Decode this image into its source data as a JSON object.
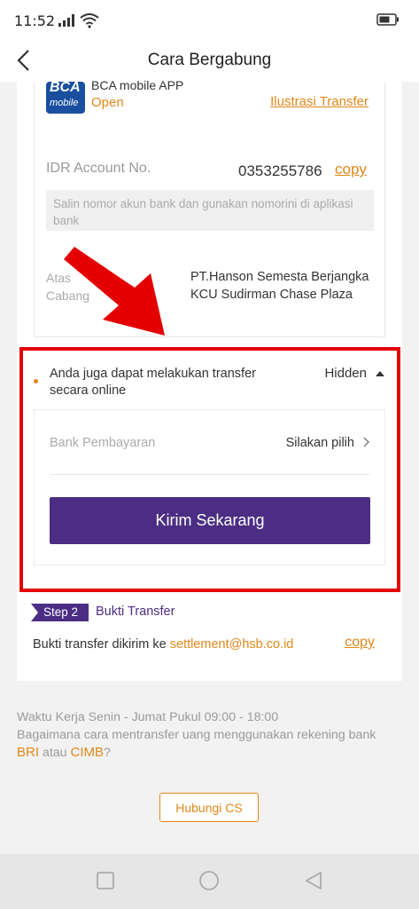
{
  "status_bar": {
    "time": "11:52"
  },
  "header": {
    "title": "Cara Bergabung"
  },
  "bca": {
    "logo_line1": "BCA",
    "logo_line2": "mobile",
    "app_name": "BCA mobile APP",
    "open_label": "Open",
    "illustration_link": "Ilustrasi Transfer"
  },
  "account": {
    "label": "IDR Account No.",
    "number": "0353255786",
    "copy_label": "copy",
    "hint": "Salin nomor akun bank dan gunakan nomorini di aplikasi bank"
  },
  "info_rows": [
    {
      "label": "Atas",
      "value": "PT.Hanson Semesta Berjangka"
    },
    {
      "label": "Cabang",
      "value": "KCU Sudirman Chase Plaza"
    }
  ],
  "online": {
    "text": "Anda juga dapat melakukan transfer secara online",
    "toggle_label": "Hidden",
    "bank_label": "Bank Pembayaran",
    "bank_value": "Silakan pilih",
    "submit_label": "Kirim Sekarang"
  },
  "step2": {
    "badge": "Step 2",
    "title": "Bukti Transfer",
    "text_prefix": "Bukti transfer dikirim ke ",
    "email": "settlement@hsb.co.id",
    "copy_label": "copy"
  },
  "footer": {
    "hours": "Waktu Kerja Senin - Jumat Pukul 09:00 - 18:00",
    "question": "Bagaimana cara mentransfer uang menggunakan rekening bank",
    "bank1": "BRI",
    "conjunction": " atau ",
    "bank2": "CIMB",
    "question_mark": "?",
    "contact_label": "Hubungi CS"
  },
  "colors": {
    "accent": "#e2871a",
    "primary": "#4b2e83",
    "highlight": "#e40000",
    "bca_blue": "#1a4f9f"
  },
  "icons": [
    "signal-icon",
    "wifi-icon",
    "battery-icon",
    "back-arrow-icon",
    "chevron-right-icon",
    "caret-up-icon",
    "square-icon",
    "circle-icon",
    "triangle-back-icon"
  ]
}
